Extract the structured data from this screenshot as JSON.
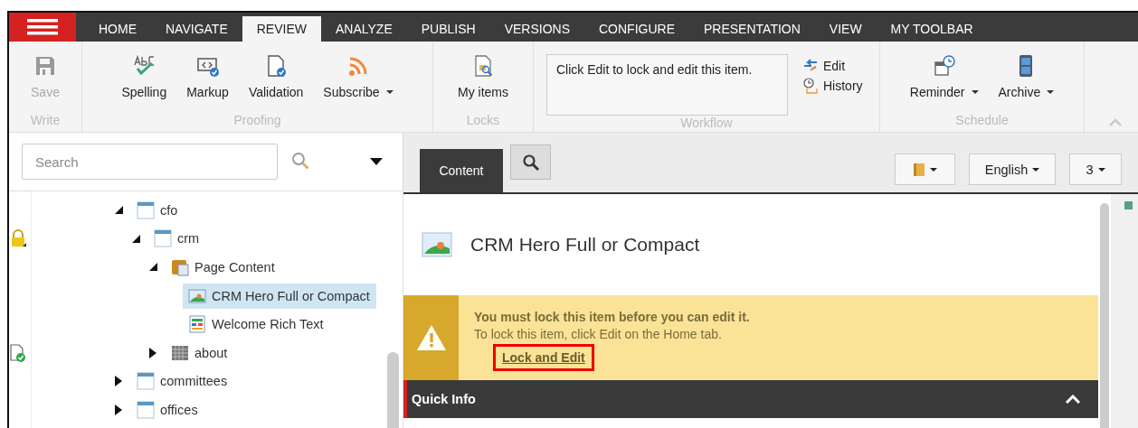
{
  "tabs": [
    {
      "label": "HOME",
      "selected": false
    },
    {
      "label": "NAVIGATE",
      "selected": false
    },
    {
      "label": "REVIEW",
      "selected": true
    },
    {
      "label": "ANALYZE",
      "selected": false
    },
    {
      "label": "PUBLISH",
      "selected": false
    },
    {
      "label": "VERSIONS",
      "selected": false
    },
    {
      "label": "CONFIGURE",
      "selected": false
    },
    {
      "label": "PRESENTATION",
      "selected": false
    },
    {
      "label": "VIEW",
      "selected": false
    },
    {
      "label": "MY TOOLBAR",
      "selected": false
    }
  ],
  "ribbon": {
    "groups": [
      {
        "label": "Write",
        "kind": "large",
        "buttons": [
          {
            "label": "Save",
            "disabled": true,
            "dropdown": false
          }
        ]
      },
      {
        "label": "Proofing",
        "kind": "large",
        "buttons": [
          {
            "label": "Spelling",
            "disabled": false,
            "dropdown": false
          },
          {
            "label": "Markup",
            "disabled": false,
            "dropdown": false
          },
          {
            "label": "Validation",
            "disabled": false,
            "dropdown": false
          },
          {
            "label": "Subscribe",
            "disabled": false,
            "dropdown": true
          }
        ]
      },
      {
        "label": "Locks",
        "kind": "large",
        "buttons": [
          {
            "label": "My items",
            "disabled": false,
            "dropdown": false
          }
        ]
      },
      {
        "label": "Workflow",
        "kind": "workflow",
        "comment": "Click Edit to lock and edit this item.",
        "buttons": [
          {
            "label": "Edit",
            "disabled": false
          },
          {
            "label": "History",
            "disabled": false
          }
        ]
      },
      {
        "label": "Schedule",
        "kind": "large",
        "buttons": [
          {
            "label": "Reminder",
            "disabled": false,
            "dropdown": true
          },
          {
            "label": "Archive",
            "disabled": false,
            "dropdown": true
          }
        ]
      }
    ]
  },
  "tree": {
    "search": {
      "placeholder": "Search"
    },
    "items": [
      {
        "label": "cfo",
        "kind": "page",
        "expanded": true,
        "selected": false,
        "locked": false,
        "validated": false,
        "children": [
          {
            "label": "crm",
            "kind": "page",
            "expanded": true,
            "selected": false,
            "locked": true,
            "validated": false,
            "children": [
              {
                "label": "Page Content",
                "kind": "content",
                "expanded": true,
                "selected": false,
                "locked": false,
                "validated": false,
                "children": [
                  {
                    "label": "CRM Hero Full or Compact",
                    "kind": "image",
                    "selected": true,
                    "locked": false,
                    "validated": false
                  },
                  {
                    "label": "Welcome Rich Text",
                    "kind": "richtext",
                    "selected": false,
                    "locked": false,
                    "validated": false
                  }
                ]
              },
              {
                "label": "about",
                "kind": "grid",
                "expanded": false,
                "selected": false,
                "locked": false,
                "validated": true
              }
            ]
          }
        ]
      },
      {
        "label": "committees",
        "kind": "page",
        "expanded": false,
        "selected": false,
        "locked": false,
        "validated": false
      },
      {
        "label": "offices",
        "kind": "page",
        "expanded": false,
        "selected": false,
        "locked": false,
        "validated": false
      }
    ]
  },
  "editor": {
    "tabs": [
      {
        "label": "Content",
        "selected": true
      }
    ],
    "language": "English",
    "version": "3",
    "item": {
      "title": "CRM Hero Full or Compact"
    },
    "warning": {
      "title": "You must lock this item before you can edit it.",
      "text": "To lock this item, click Edit on the Home tab.",
      "link": "Lock and Edit",
      "highlighted": true
    },
    "sections": [
      {
        "title": "Quick Info",
        "expanded": true
      }
    ]
  }
}
